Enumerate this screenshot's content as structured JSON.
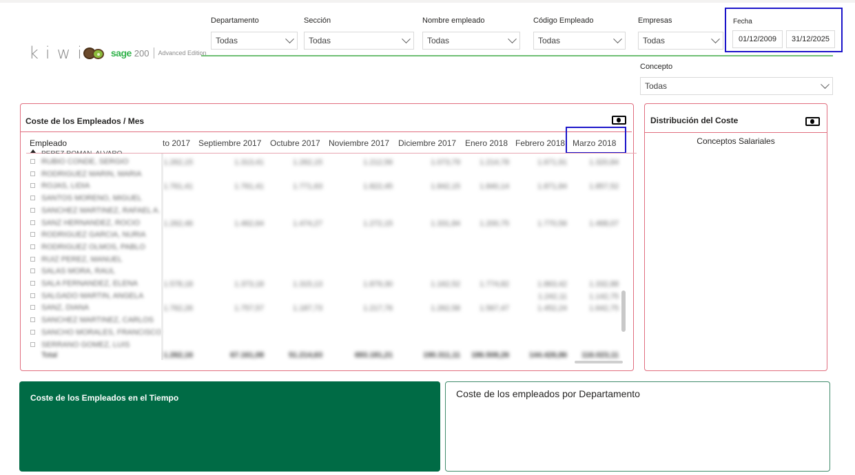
{
  "logo": {
    "kiwi": "kiwi",
    "sage": "sage",
    "sage_version": "200",
    "edition": "Advanced Edition"
  },
  "slicers": [
    {
      "label": "Departamento",
      "value": "Todas"
    },
    {
      "label": "Sección",
      "value": "Todas"
    },
    {
      "label": "Nombre empleado",
      "value": "Todas"
    },
    {
      "label": "Código Empleado",
      "value": "Todas"
    },
    {
      "label": "Empresas",
      "value": "Todas"
    }
  ],
  "concepto": {
    "label": "Concepto",
    "value": "Todas"
  },
  "fecha": {
    "label": "Fecha",
    "start": "01/12/2009",
    "end": "31/12/2025"
  },
  "matrix": {
    "title": "Coste de los Empleados / Mes",
    "row_header": "Empleado",
    "first_row_partial": "PEREZ ROMAN, ALVARO",
    "columns": [
      "to 2017",
      "Septiembre 2017",
      "Octubre 2017",
      "Noviembre 2017",
      "Diciembre 2017",
      "Enero 2018",
      "Febrero 2018",
      "Marzo 2018"
    ],
    "rows": [
      {
        "name": "RUBIO CONDE, SERGIO",
        "values": [
          "1.262,15",
          "1.313,41",
          "1.262,15",
          "1.212,56",
          "1.073,79",
          "1.214,78",
          "1.671,91",
          "1.320,84"
        ]
      },
      {
        "name": "RODRIGUEZ MARIN, MARIA",
        "values": [
          "",
          "",
          "",
          "",
          "",
          "",
          "",
          ""
        ]
      },
      {
        "name": "ROJAS, LIDIA",
        "values": [
          "1.761,41",
          "1.761,41",
          "1.771,63",
          "1.822,45",
          "1.842,15",
          "1.840,14",
          "1.871,84",
          "1.857,52"
        ]
      },
      {
        "name": "SANTOS MORENO, MIGUEL",
        "values": [
          "",
          "",
          "",
          "",
          "",
          "",
          "",
          ""
        ]
      },
      {
        "name": "SANCHEZ MARTINEZ, RAFAEL A.",
        "values": [
          "",
          "",
          "",
          "",
          "",
          "",
          "",
          ""
        ]
      },
      {
        "name": "SANZ HERNANDEZ, ROCIO",
        "values": [
          "1.262,46",
          "1.462,64",
          "1.474,27",
          "1.272,15",
          "1.331,84",
          "1.200,75",
          "1.770,56",
          "1.468,07"
        ]
      },
      {
        "name": "RODRIGUEZ GARCIA, NURIA",
        "values": [
          "",
          "",
          "",
          "",
          "",
          "",
          "",
          ""
        ]
      },
      {
        "name": "RODRIGUEZ OLMOS, PABLO",
        "values": [
          "",
          "",
          "",
          "",
          "",
          "",
          "",
          ""
        ]
      },
      {
        "name": "RUIZ PEREZ, MANUEL",
        "values": [
          "",
          "",
          "",
          "",
          "",
          "",
          "",
          ""
        ]
      },
      {
        "name": "SALAS MORA, RAUL",
        "values": [
          "",
          "",
          "",
          "",
          "",
          "",
          "",
          ""
        ]
      },
      {
        "name": "SALA FERNANDEZ, ELENA",
        "values": [
          "1.578,18",
          "1.373,18",
          "1.315,13",
          "1.879,30",
          "1.162,52",
          "1.774,82",
          "1.863,42",
          "1.332,88"
        ]
      },
      {
        "name": "SALGADO MARTIN, ANGELA",
        "values": [
          "",
          "",
          "",
          "",
          "",
          "",
          "1.242,11",
          "1.142,75"
        ]
      },
      {
        "name": "SANZ, DIANA",
        "values": [
          "1.762,26",
          "1.757,57",
          "1.187,73",
          "1.217,76",
          "1.262,58",
          "1.567,47",
          "1.452,24",
          "1.642,75"
        ]
      },
      {
        "name": "SANCHEZ MARTINEZ, CARLOS",
        "values": [
          "",
          "",
          "",
          "",
          "",
          "",
          "",
          ""
        ]
      },
      {
        "name": "SANCHO MORALES, FRANCISCO",
        "values": [
          "",
          "",
          "",
          "",
          "",
          "",
          "",
          ""
        ]
      },
      {
        "name": "SERRANO GOMEZ, LUIS",
        "values": [
          "",
          "",
          "",
          "",
          "",
          "",
          "",
          ""
        ]
      }
    ],
    "total": {
      "label": "Total",
      "values": [
        "1.262,16",
        "67.161,08",
        "51.214,63",
        "693.181,21",
        "190.311,11",
        "186.508,26",
        "144.426,86",
        "116.023,11"
      ]
    }
  },
  "distribucion": {
    "title": "Distribución del Coste",
    "subtitle": "Conceptos Salariales"
  },
  "tiles": {
    "tiempo": "Coste de los Empleados en el Tiempo",
    "departamento": "Coste de los empleados por Departamento"
  },
  "colors": {
    "accent_green": "#006b45",
    "panel_border": "#e06c7d",
    "highlight": "#1a13c9",
    "logo_green": "#30b24a"
  },
  "icons": [
    "money-icon",
    "chevron-down-icon",
    "expand-icon",
    "sort-ascending-icon"
  ]
}
